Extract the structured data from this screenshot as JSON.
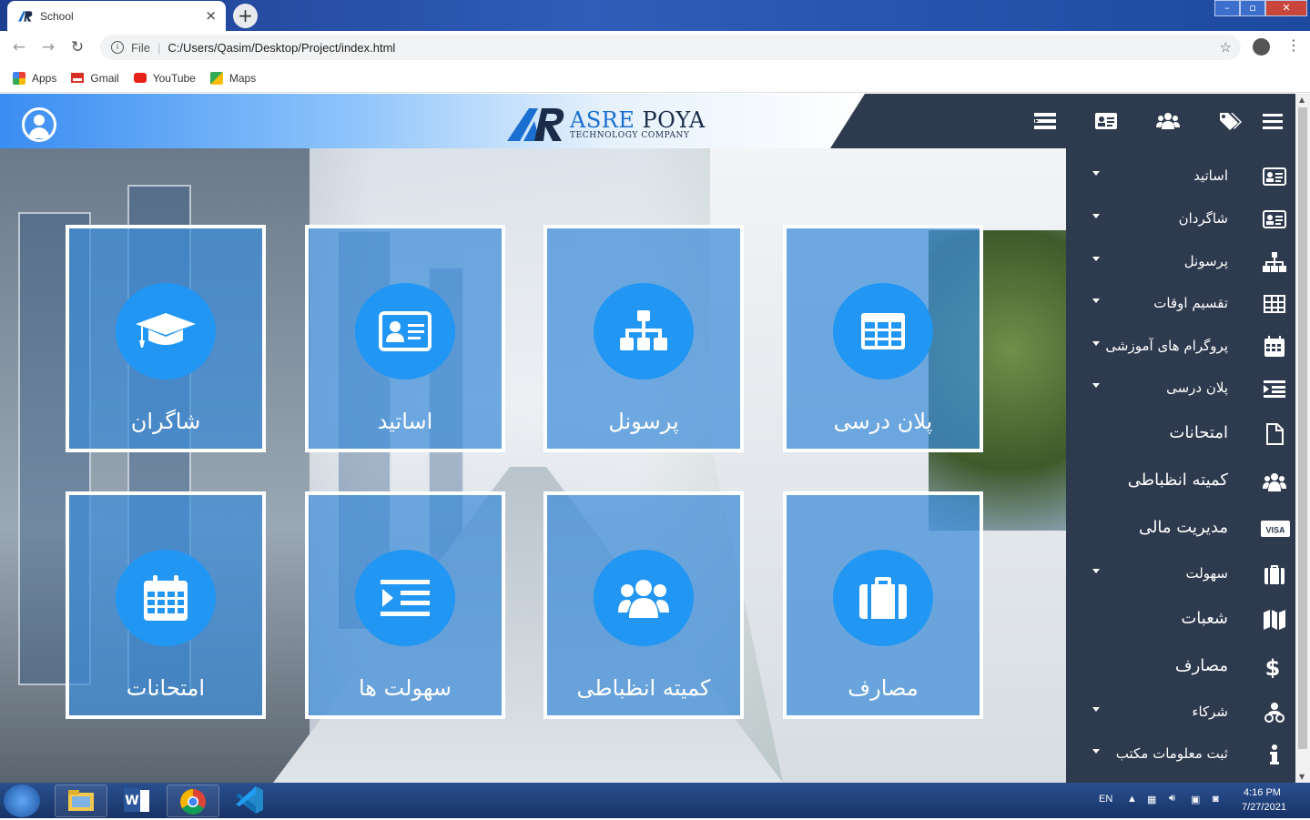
{
  "browser": {
    "tab_title": "School",
    "url_scheme_label": "File",
    "url": "C:/Users/Qasim/Desktop/Project/index.html",
    "bookmarks": [
      {
        "label": "Apps",
        "icon": "apps-grid-icon"
      },
      {
        "label": "Gmail",
        "icon": "gmail-icon"
      },
      {
        "label": "YouTube",
        "icon": "youtube-icon"
      },
      {
        "label": "Maps",
        "icon": "maps-icon"
      }
    ]
  },
  "header": {
    "brand_word1": "ASRE",
    "brand_word2": "POYA",
    "brand_tagline": "TECHNOLOGY COMPANY",
    "icons": [
      "list-icon",
      "id-card-icon",
      "users-icon",
      "tags-icon",
      "hamburger-menu-icon"
    ]
  },
  "tiles": [
    {
      "label": "شاگران",
      "icon": "graduation-cap-icon"
    },
    {
      "label": "اساتید",
      "icon": "id-card-icon"
    },
    {
      "label": "پرسونل",
      "icon": "sitemap-icon"
    },
    {
      "label": "پلان درسی",
      "icon": "table-icon"
    },
    {
      "label": "امتحانات",
      "icon": "calendar-icon"
    },
    {
      "label": "سهولت ها",
      "icon": "list-icon"
    },
    {
      "label": "کمیته انظباطی",
      "icon": "users-icon"
    },
    {
      "label": "مصارف",
      "icon": "briefcase-icon"
    }
  ],
  "sidebar": {
    "items": [
      {
        "label": "اساتید",
        "icon": "id-card-icon",
        "dropdown": true
      },
      {
        "label": "شاگردان",
        "icon": "id-card-icon",
        "dropdown": true
      },
      {
        "label": "پرسونل",
        "icon": "sitemap-icon",
        "dropdown": true
      },
      {
        "label": "تقسیم اوقات",
        "icon": "table-icon",
        "dropdown": true
      },
      {
        "label": "پروگرام های آموزشی",
        "icon": "calendar-icon",
        "dropdown": true
      },
      {
        "label": "پلان درسی",
        "icon": "list-icon",
        "dropdown": true
      },
      {
        "label": "امتحانات",
        "icon": "file-icon",
        "dropdown": false
      },
      {
        "label": "کمیته انظباطی",
        "icon": "users-icon",
        "dropdown": false
      },
      {
        "label": "مدیریت مالی",
        "icon": "visa-card-icon",
        "dropdown": false,
        "visa_text": "VISA"
      },
      {
        "label": "سهولت",
        "icon": "briefcase-icon",
        "dropdown": true
      },
      {
        "label": "شعبات",
        "icon": "map-icon",
        "dropdown": false
      },
      {
        "label": "مصارف",
        "icon": "dollar-icon",
        "dropdown": false
      },
      {
        "label": "شرکاء",
        "icon": "partners-icon",
        "dropdown": true
      },
      {
        "label": "ثبت معلومات مکتب",
        "icon": "info-icon",
        "dropdown": true
      }
    ]
  },
  "taskbar": {
    "language": "EN",
    "time": "4:16 PM",
    "date": "7/27/2021"
  }
}
